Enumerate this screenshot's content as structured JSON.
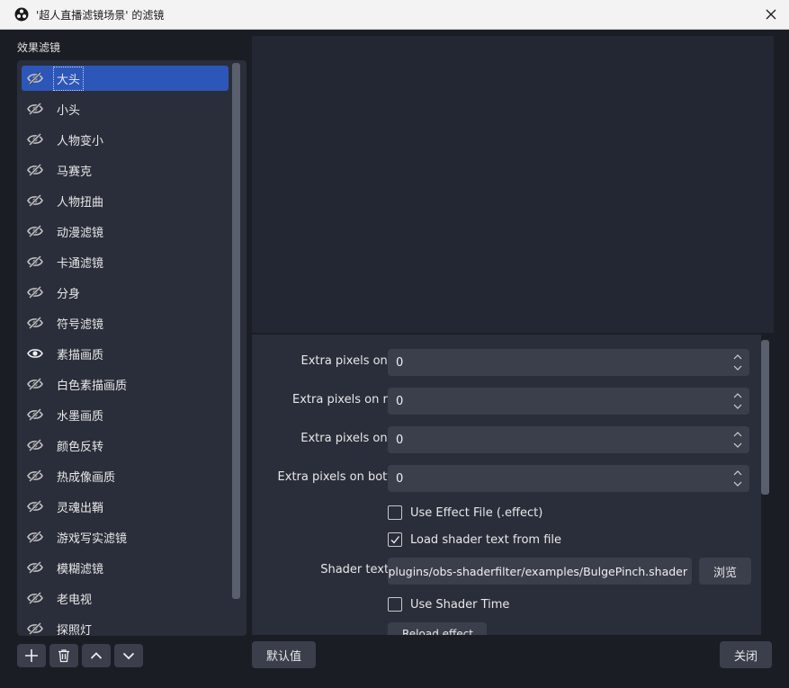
{
  "window": {
    "title": "'超人直播滤镜场景' 的滤镜",
    "close_icon": "close-icon"
  },
  "sidebar": {
    "section_label": "效果滤镜",
    "items": [
      {
        "label": "大头",
        "visible": false,
        "selected": true
      },
      {
        "label": "小头",
        "visible": false
      },
      {
        "label": "人物变小",
        "visible": false
      },
      {
        "label": "马赛克",
        "visible": false
      },
      {
        "label": "人物扭曲",
        "visible": false
      },
      {
        "label": "动漫滤镜",
        "visible": false
      },
      {
        "label": "卡通滤镜",
        "visible": false
      },
      {
        "label": "分身",
        "visible": false
      },
      {
        "label": "符号滤镜",
        "visible": false
      },
      {
        "label": "素描画质",
        "visible": true
      },
      {
        "label": "白色素描画质",
        "visible": false
      },
      {
        "label": "水墨画质",
        "visible": false
      },
      {
        "label": "颜色反转",
        "visible": false
      },
      {
        "label": "热成像画质",
        "visible": false
      },
      {
        "label": "灵魂出鞘",
        "visible": false
      },
      {
        "label": "游戏写实滤镜",
        "visible": false
      },
      {
        "label": "模糊滤镜",
        "visible": false
      },
      {
        "label": "老电视",
        "visible": false
      },
      {
        "label": "探照灯",
        "visible": false
      }
    ]
  },
  "properties": {
    "extra_left_label": "Extra pixels on left",
    "extra_left_value": "0",
    "extra_right_label": "Extra pixels on right",
    "extra_right_value": "0",
    "extra_top_label": "Extra pixels on top",
    "extra_top_value": "0",
    "extra_bottom_label": "Extra pixels on bottom",
    "extra_bottom_value": "0",
    "use_effect_file_label": "Use Effect File (.effect)",
    "use_effect_file_checked": false,
    "load_shader_label": "Load shader text from file",
    "load_shader_checked": true,
    "shader_file_label": "Shader text file",
    "shader_file_value": "-plugins/obs-shaderfilter/examples/BulgePinch.shader",
    "browse_label": "浏览",
    "use_shader_time_label": "Use Shader Time",
    "use_shader_time_checked": false,
    "partial_button_label": "Reload effect"
  },
  "footer": {
    "defaults_label": "默认值",
    "close_label": "关闭",
    "add_icon": "plus-icon",
    "remove_icon": "trash-icon",
    "move_up_icon": "chevron-up-icon",
    "move_down_icon": "chevron-down-icon"
  },
  "colors": {
    "background": "#1b1d25",
    "panel": "#2a2e3a",
    "selection": "#2c56b8",
    "control": "#3b3f4c"
  }
}
